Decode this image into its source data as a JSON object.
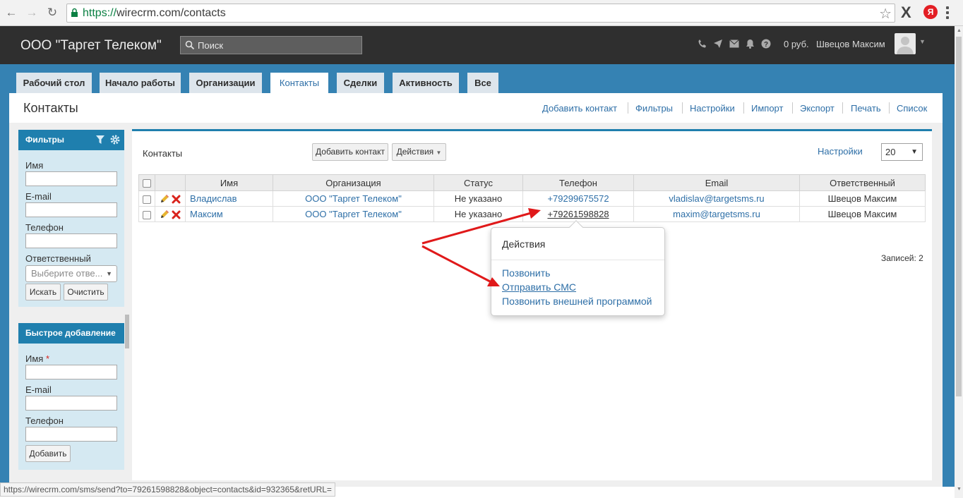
{
  "browser": {
    "url_scheme": "https://",
    "url_rest": "wirecrm.com/contacts",
    "ext_ya": "Я"
  },
  "header": {
    "title": "ООО \"Таргет Телеком\"",
    "search_placeholder": "Поиск",
    "balance": "0 руб.",
    "user": "Швецов Максим"
  },
  "tabs": [
    {
      "label": "Рабочий стол"
    },
    {
      "label": "Начало работы"
    },
    {
      "label": "Организации"
    },
    {
      "label": "Контакты"
    },
    {
      "label": "Сделки"
    },
    {
      "label": "Активность"
    },
    {
      "label": "Все"
    }
  ],
  "page": {
    "title": "Контакты",
    "actions": [
      "Добавить контакт",
      "Фильтры",
      "Настройки",
      "Импорт",
      "Экспорт",
      "Печать",
      "Список"
    ]
  },
  "filters": {
    "title": "Фильтры",
    "name_label": "Имя",
    "email_label": "E-mail",
    "phone_label": "Телефон",
    "responsible_label": "Ответственный",
    "responsible_placeholder": "Выберите отве...",
    "search_btn": "Искать",
    "clear_btn": "Очистить"
  },
  "quick_add": {
    "title": "Быстрое добавление",
    "name_label": "Имя",
    "required_mark": "*",
    "email_label": "E-mail",
    "phone_label": "Телефон",
    "add_btn": "Добавить"
  },
  "main": {
    "title": "Контакты",
    "add_btn": "Добавить контакт",
    "actions_btn": "Действия",
    "settings_link": "Настройки",
    "page_size": "20",
    "records": "Записей: 2"
  },
  "table": {
    "columns": [
      "Имя",
      "Организация",
      "Статус",
      "Телефон",
      "Email",
      "Ответственный"
    ],
    "rows": [
      {
        "name": "Владислав",
        "org": "ООО \"Таргет Телеком\"",
        "status": "Не указано",
        "phone": "+79299675572",
        "email": "vladislav@targetsms.ru",
        "owner": "Швецов Максим"
      },
      {
        "name": "Максим",
        "org": "ООО \"Таргет Телеком\"",
        "status": "Не указано",
        "phone": "+79261598828",
        "email": "maxim@targetsms.ru",
        "owner": "Швецов Максим"
      }
    ]
  },
  "popover": {
    "title": "Действия",
    "items": [
      "Позвонить",
      "Отправить СМС",
      "Позвонить внешней программой"
    ]
  },
  "statusbar": {
    "text": "https://wirecrm.com/sms/send?to=79261598828&object=contacts&id=932365&retURL="
  },
  "colors": {
    "header_bg": "#2f2f2f",
    "tab_band": "#3582b3",
    "panel_head": "#1f7fae",
    "link": "#2e6fa7",
    "arrow": "#e0191a"
  }
}
